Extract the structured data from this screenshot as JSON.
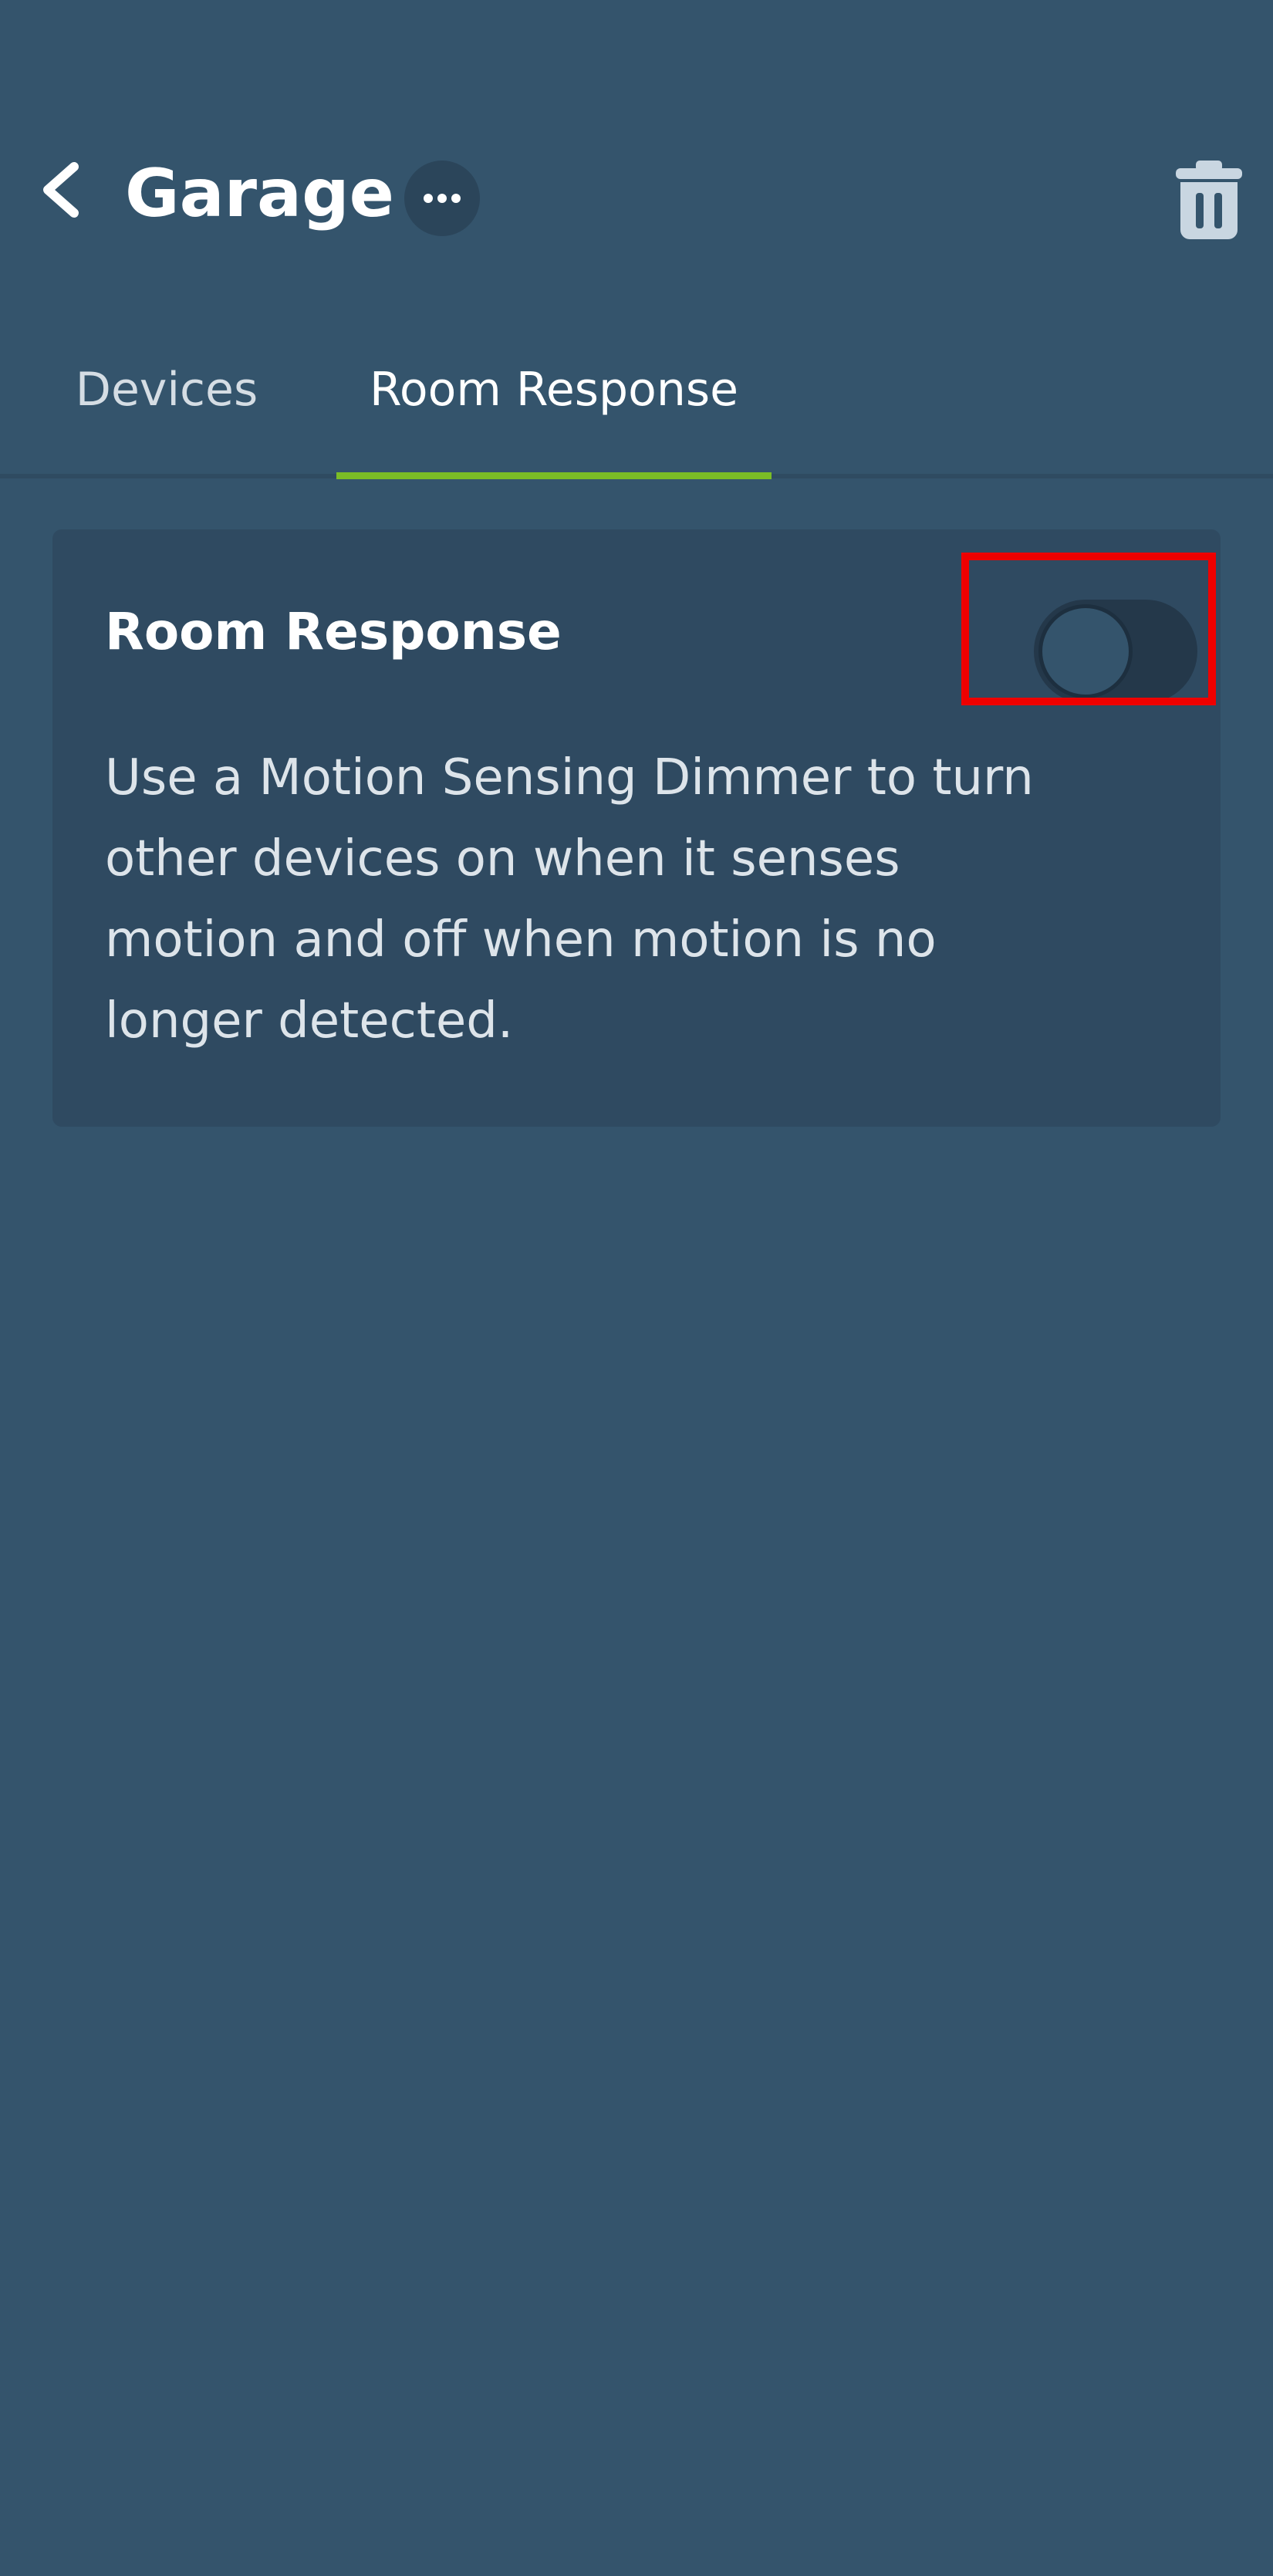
{
  "header": {
    "title": "Garage",
    "back_icon": "chevron-left-icon",
    "more_icon": "ellipsis-icon",
    "delete_icon": "trash-icon"
  },
  "tabs": [
    {
      "label": "Devices",
      "active": false
    },
    {
      "label": "Room Response",
      "active": true
    }
  ],
  "room_response": {
    "title": "Room Response",
    "description": "Use a Motion Sensing Dimmer to turn other devices on when it senses motion and off when motion is no longer detected.",
    "toggle_on": false
  },
  "colors": {
    "background": "#34546c",
    "card": "#2f4a61",
    "accent": "#7bbd26",
    "highlight": "#ee0000"
  }
}
